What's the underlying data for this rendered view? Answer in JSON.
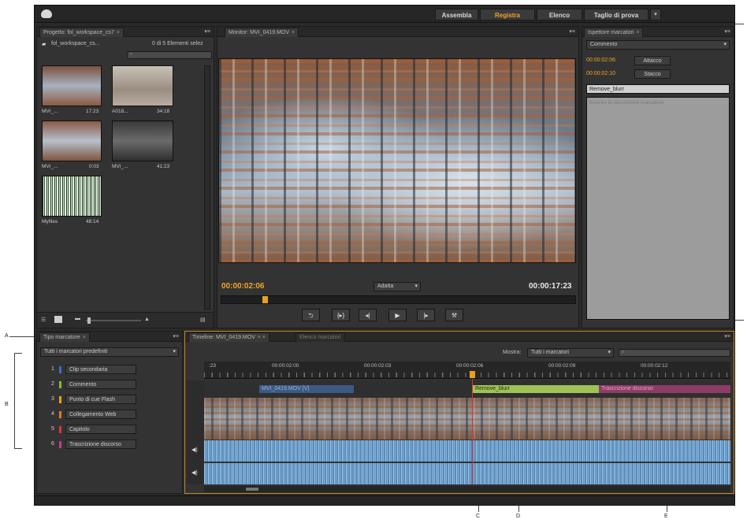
{
  "workspaces": [
    "Assembla",
    "Registra",
    "Elenco",
    "Taglio di prova"
  ],
  "project": {
    "tab": "Progetto: fol_workspace_cs7",
    "name": "fol_workspace_cs...",
    "selection": "0 di 5 Elementi selez",
    "clips": [
      {
        "name": "MVI_...",
        "duration": "17:23"
      },
      {
        "name": "A018...",
        "duration": "34:18"
      },
      {
        "name": "MVI_...",
        "duration": "0:03"
      },
      {
        "name": "MVI_...",
        "duration": "41:23"
      },
      {
        "name": "Myfiles",
        "duration": "48:14"
      }
    ]
  },
  "monitor": {
    "tab": "Monitor: MVI_0419.MOV",
    "current_time": "00:00:02:06",
    "fit": "Adatta",
    "duration": "00:00:17:23"
  },
  "inspector": {
    "tab": "Ispettore marcatori",
    "type": "Commento",
    "in_time": "00:00:02:06",
    "in_label": "Attacco",
    "out_time": "00:00:02:10",
    "out_label": "Stacco",
    "name_value": "Remove_blurr",
    "desc_placeholder": "Inserire la descrizione marcatore"
  },
  "marker_types": {
    "tab": "Tipo marcatore",
    "dropdown": "Tutti i marcatori predefiniti",
    "items": [
      {
        "num": "1",
        "label": "Clip secondaria",
        "color": "#3b6fc4"
      },
      {
        "num": "2",
        "label": "Commento",
        "color": "#8fb43a"
      },
      {
        "num": "3",
        "label": "Punto di cue Flash",
        "color": "#e8a020"
      },
      {
        "num": "4",
        "label": "Collegamento Web",
        "color": "#e07b20"
      },
      {
        "num": "5",
        "label": "Capitolo",
        "color": "#d83a3a"
      },
      {
        "num": "6",
        "label": "Trascrizione discorso",
        "color": "#c63c8c"
      }
    ]
  },
  "timeline": {
    "tab": "Timeline: MVI_0419.MOV",
    "tab2": "Elenco marcatori",
    "show_label": "Mostra:",
    "show_value": "Tutti i marcatori",
    "ruler": [
      ":23",
      "00:00:02:00",
      "00:00:02:03",
      "00:00:02:06",
      "00:00:02:09",
      "00:00:02:12"
    ],
    "clip1": "MVI_0419.MOV [V]",
    "clip2": "Remove_blurr",
    "clip3": "Trascrizione discorso"
  },
  "callouts": {
    "a": "A",
    "b": "B",
    "c": "C",
    "d": "D",
    "e": "E"
  }
}
